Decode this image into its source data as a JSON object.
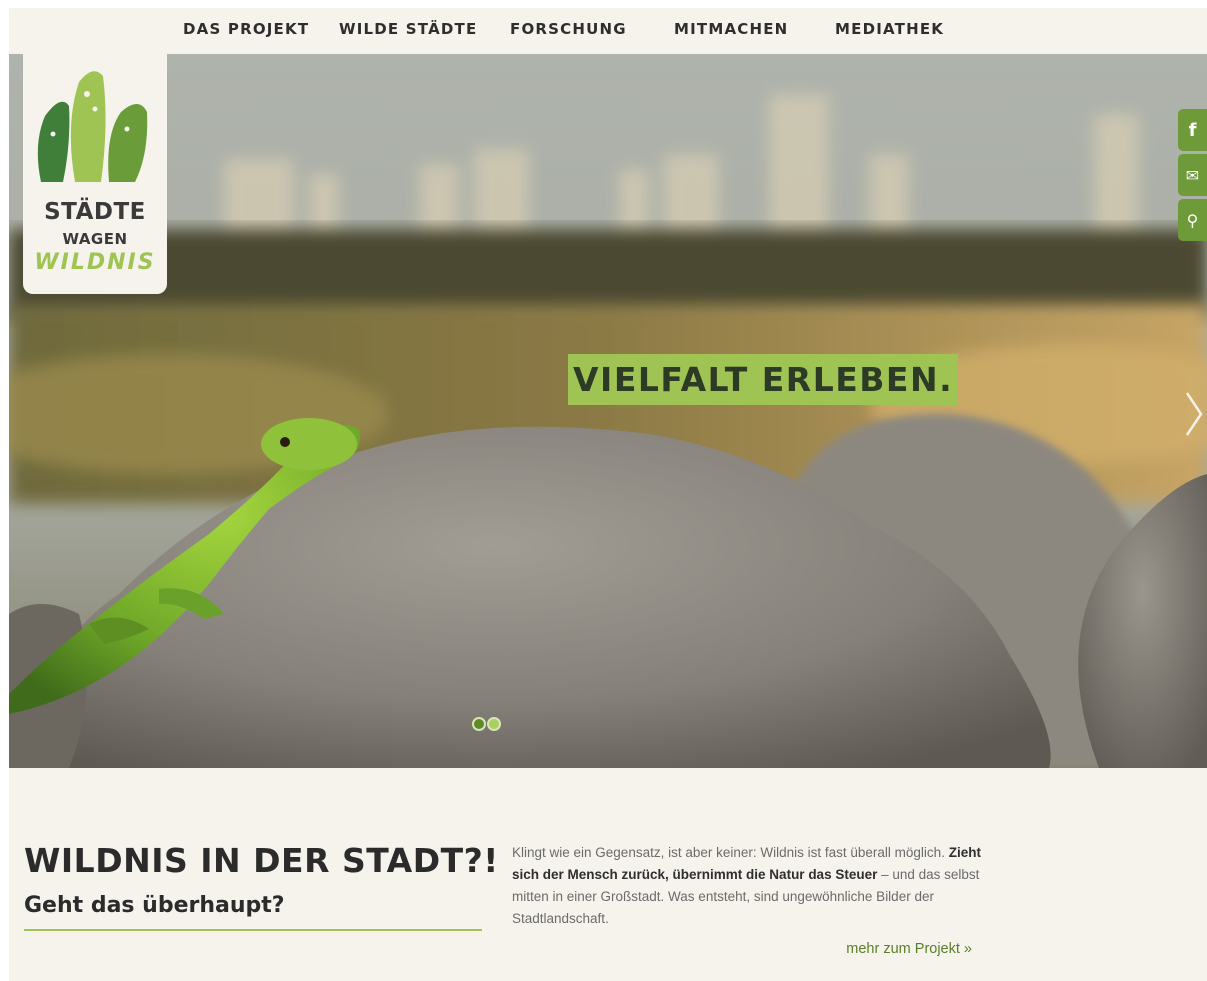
{
  "nav": {
    "items": [
      {
        "label": "DAS PROJEKT"
      },
      {
        "label": "WILDE STÄDTE"
      },
      {
        "label": "FORSCHUNG"
      },
      {
        "label": "MITMACHEN"
      },
      {
        "label": "MEDIATHEK"
      }
    ]
  },
  "logo": {
    "line1": "STÄDTE",
    "line2": "WAGEN",
    "line3": "WILDNIS"
  },
  "hero": {
    "slogan": "VIELFALT ERLEBEN.",
    "slide_count": 2,
    "active_slide": 1
  },
  "social": {
    "facebook_icon": "f",
    "mail_icon": "✉",
    "search_icon": "⚲"
  },
  "intro": {
    "title": "WILDNIS IN DER STADT?!",
    "subtitle": "Geht das überhaupt?",
    "text_part1": "Klingt wie ein Gegensatz, ist aber keiner: Wildnis ist fast überall möglich. ",
    "text_bold": "Zieht sich der Mensch zurück, übernimmt die Natur das Steuer",
    "text_part2": " – und das selbst mitten in einer Großstadt. Was entsteht, sind ungewöhnliche Bilder der Stadtlandschaft.",
    "more_link": "mehr zum Projekt »"
  },
  "colors": {
    "accent_green": "#9fc454",
    "dark_green": "#5f8a2b",
    "social_green": "#6f9a3a",
    "background": "#f6f3ec"
  }
}
